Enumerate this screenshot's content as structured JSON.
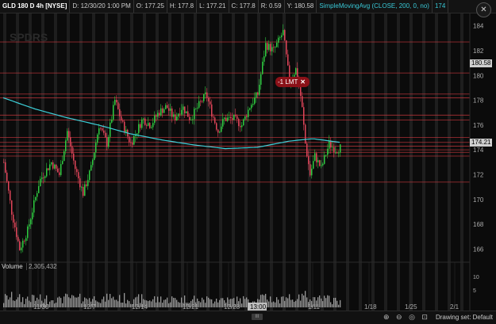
{
  "header": {
    "symbol": "GLD 180 D 4h [NYSE]",
    "date": "D: 12/30/20 1:00 PM",
    "open": "O: 177.25",
    "high": "H: 177.8",
    "low": "L: 177.21",
    "close": "C: 177.8",
    "range": "R: 0.59",
    "last": "Y: 180.58",
    "indicator": "SimpleMovingAvg (CLOSE, 200, 0, no)",
    "indicator_value": "174"
  },
  "order": {
    "label": "-1 LMT",
    "close_glyph": "✕"
  },
  "price_tags": {
    "top": "180.58",
    "current": "174.21"
  },
  "volume": {
    "label": "Volume",
    "value": "2,305,432"
  },
  "footer": {
    "drawing_set": "Drawing set: Default",
    "scroll_handle": "III",
    "icons": "⊕ ⊖ ◎ ⊡"
  },
  "watermark": "SPDRS",
  "colors": {
    "up": "#2ecc40",
    "down": "#e0455a",
    "sma": "#3ccfd8",
    "level": "#c8373d"
  },
  "chart_data": {
    "type": "candlestick",
    "y_ticks": [
      "184",
      "182",
      "180",
      "178",
      "176",
      "174",
      "172",
      "170",
      "168",
      "166"
    ],
    "y_range": [
      165,
      185
    ],
    "x_ticks": [
      "11/30",
      "12/7",
      "12/14",
      "12/21",
      "12/28",
      "1/11",
      "1/18",
      "1/25",
      "2/1"
    ],
    "x_highlight": "13:00",
    "vol_ticks": [
      "10",
      "5"
    ],
    "price_levels": [
      182.7,
      180.2,
      178.5,
      178.2,
      176.8,
      176.4,
      175.0,
      174.6,
      174.3,
      174.0,
      173.8,
      173.5,
      171.4
    ],
    "anchors": [
      {
        "t": 0,
        "p": 173
      },
      {
        "t": 10,
        "p": 169
      },
      {
        "t": 20,
        "p": 166
      },
      {
        "t": 30,
        "p": 167.5
      },
      {
        "t": 45,
        "p": 171.5
      },
      {
        "t": 60,
        "p": 173
      },
      {
        "t": 70,
        "p": 172
      },
      {
        "t": 80,
        "p": 175.5
      },
      {
        "t": 90,
        "p": 172.5
      },
      {
        "t": 100,
        "p": 170.5
      },
      {
        "t": 110,
        "p": 172.5
      },
      {
        "t": 120,
        "p": 176
      },
      {
        "t": 130,
        "p": 174.5
      },
      {
        "t": 140,
        "p": 178
      },
      {
        "t": 150,
        "p": 176
      },
      {
        "t": 160,
        "p": 174.5
      },
      {
        "t": 175,
        "p": 176.5
      },
      {
        "t": 185,
        "p": 176
      },
      {
        "t": 195,
        "p": 177
      },
      {
        "t": 205,
        "p": 177.5
      },
      {
        "t": 215,
        "p": 176.5
      },
      {
        "t": 225,
        "p": 177.5
      },
      {
        "t": 235,
        "p": 176.5
      },
      {
        "t": 245,
        "p": 177.5
      },
      {
        "t": 255,
        "p": 178.5
      },
      {
        "t": 262,
        "p": 177
      },
      {
        "t": 270,
        "p": 175.5
      },
      {
        "t": 278,
        "p": 176.5
      },
      {
        "t": 290,
        "p": 176.5
      },
      {
        "t": 300,
        "p": 176
      },
      {
        "t": 310,
        "p": 177.5
      },
      {
        "t": 320,
        "p": 178.5
      },
      {
        "t": 330,
        "p": 182.5
      },
      {
        "t": 340,
        "p": 182
      },
      {
        "t": 352,
        "p": 183.5
      },
      {
        "t": 360,
        "p": 179.5
      },
      {
        "t": 368,
        "p": 180.5
      },
      {
        "t": 375,
        "p": 178
      },
      {
        "t": 380,
        "p": 174.5
      },
      {
        "t": 386,
        "p": 172
      },
      {
        "t": 392,
        "p": 173.5
      },
      {
        "t": 400,
        "p": 172.5
      },
      {
        "t": 410,
        "p": 174.5
      },
      {
        "t": 418,
        "p": 174
      },
      {
        "t": 425,
        "p": 174.2
      }
    ],
    "sma": [
      {
        "t": 0,
        "p": 178.2
      },
      {
        "t": 40,
        "p": 177.3
      },
      {
        "t": 80,
        "p": 176.6
      },
      {
        "t": 120,
        "p": 176
      },
      {
        "t": 160,
        "p": 175.3
      },
      {
        "t": 200,
        "p": 174.8
      },
      {
        "t": 240,
        "p": 174.4
      },
      {
        "t": 280,
        "p": 174.1
      },
      {
        "t": 320,
        "p": 174.2
      },
      {
        "t": 360,
        "p": 174.7
      },
      {
        "t": 390,
        "p": 174.9
      },
      {
        "t": 425,
        "p": 174.6
      }
    ]
  }
}
